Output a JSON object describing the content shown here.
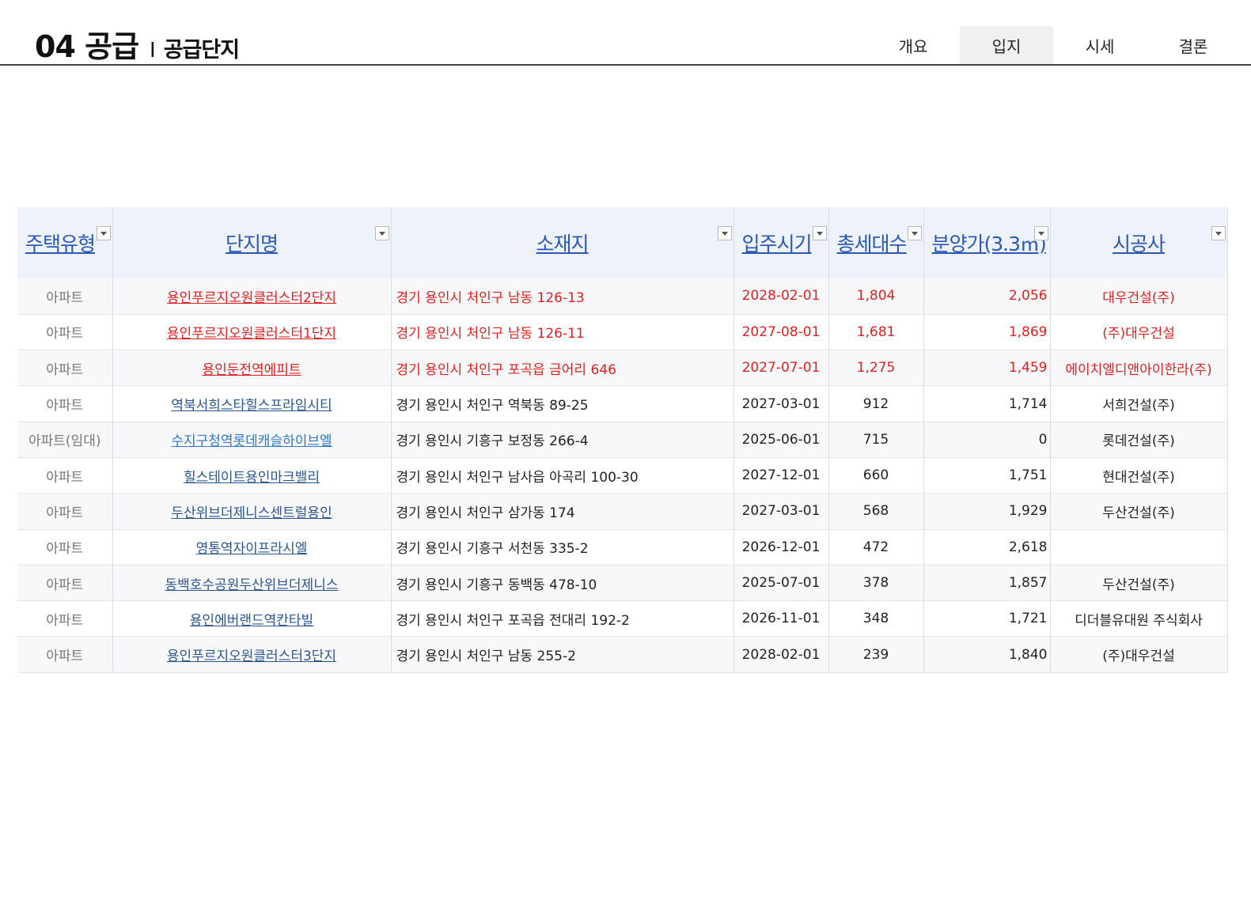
{
  "header": {
    "title_main": "04 공급",
    "title_sep": "I",
    "title_sub": "공급단지"
  },
  "nav": {
    "tabs": [
      {
        "label": "개요"
      },
      {
        "label": "입지"
      },
      {
        "label": "시세"
      },
      {
        "label": "결론"
      }
    ],
    "active_tab": "입지"
  },
  "table": {
    "columns": [
      "주택유형",
      "단지명",
      "소재지",
      "입주시기",
      "총세대수",
      "분양가(3.3㎡)",
      "시공사"
    ],
    "rows": [
      {
        "type": "아파트",
        "name": "용인푸르지오원클러스터2단지",
        "address": "경기 용인시 처인구 남동 126-13",
        "move_in": "2028-02-01",
        "units": "1,804",
        "price": "2,056",
        "builder": "대우건설(주)"
      },
      {
        "type": "아파트",
        "name": "용인푸르지오원클러스터1단지",
        "address": "경기 용인시 처인구 남동 126-11",
        "move_in": "2027-08-01",
        "units": "1,681",
        "price": "1,869",
        "builder": "(주)대우건설"
      },
      {
        "type": "아파트",
        "name": "용인둔전역에피트",
        "address": "경기 용인시 처인구 포곡읍 금어리 646",
        "move_in": "2027-07-01",
        "units": "1,275",
        "price": "1,459",
        "builder": "에이치엘디앤아이한라(주)"
      },
      {
        "type": "아파트",
        "name": "역북서희스타힐스프라임시티",
        "address": "경기 용인시 처인구 역북동 89-25",
        "move_in": "2027-03-01",
        "units": "912",
        "price": "1,714",
        "builder": "서희건설(주)"
      },
      {
        "type": "아파트(임대)",
        "name": "수지구청역롯데캐슬하이브엘",
        "address": "경기 용인시 기흥구 보정동 266-4",
        "move_in": "2025-06-01",
        "units": "715",
        "price": "0",
        "builder": "롯데건설(주)"
      },
      {
        "type": "아파트",
        "name": "힐스테이트용인마크밸리",
        "address": "경기 용인시 처인구 남사읍 아곡리 100-30",
        "move_in": "2027-12-01",
        "units": "660",
        "price": "1,751",
        "builder": "현대건설(주)"
      },
      {
        "type": "아파트",
        "name": "두산위브더제니스센트럴용인",
        "address": "경기 용인시 처인구 삼가동 174",
        "move_in": "2027-03-01",
        "units": "568",
        "price": "1,929",
        "builder": "두산건설(주)"
      },
      {
        "type": "아파트",
        "name": "영통역자이프라시엘",
        "address": "경기 용인시 기흥구 서천동 335-2",
        "move_in": "2026-12-01",
        "units": "472",
        "price": "2,618",
        "builder": ""
      },
      {
        "type": "아파트",
        "name": "동백호수공원두산위브더제니스",
        "address": "경기 용인시 기흥구 동백동 478-10",
        "move_in": "2025-07-01",
        "units": "378",
        "price": "1,857",
        "builder": "두산건설(주)"
      },
      {
        "type": "아파트",
        "name": "용인에버랜드역칸타빌",
        "address": "경기 용인시 처인구 포곡읍 전대리 192-2",
        "move_in": "2026-11-01",
        "units": "348",
        "price": "1,721",
        "builder": "디더블유대원 주식회사"
      },
      {
        "type": "아파트",
        "name": "용인푸르지오원클러스터3단지",
        "address": "경기 용인시 처인구 남동 255-2",
        "move_in": "2028-02-01",
        "units": "239",
        "price": "1,840",
        "builder": "(주)대우건설"
      }
    ],
    "highlight_color": "#e02020",
    "header_text_color": "#2c58b8"
  }
}
